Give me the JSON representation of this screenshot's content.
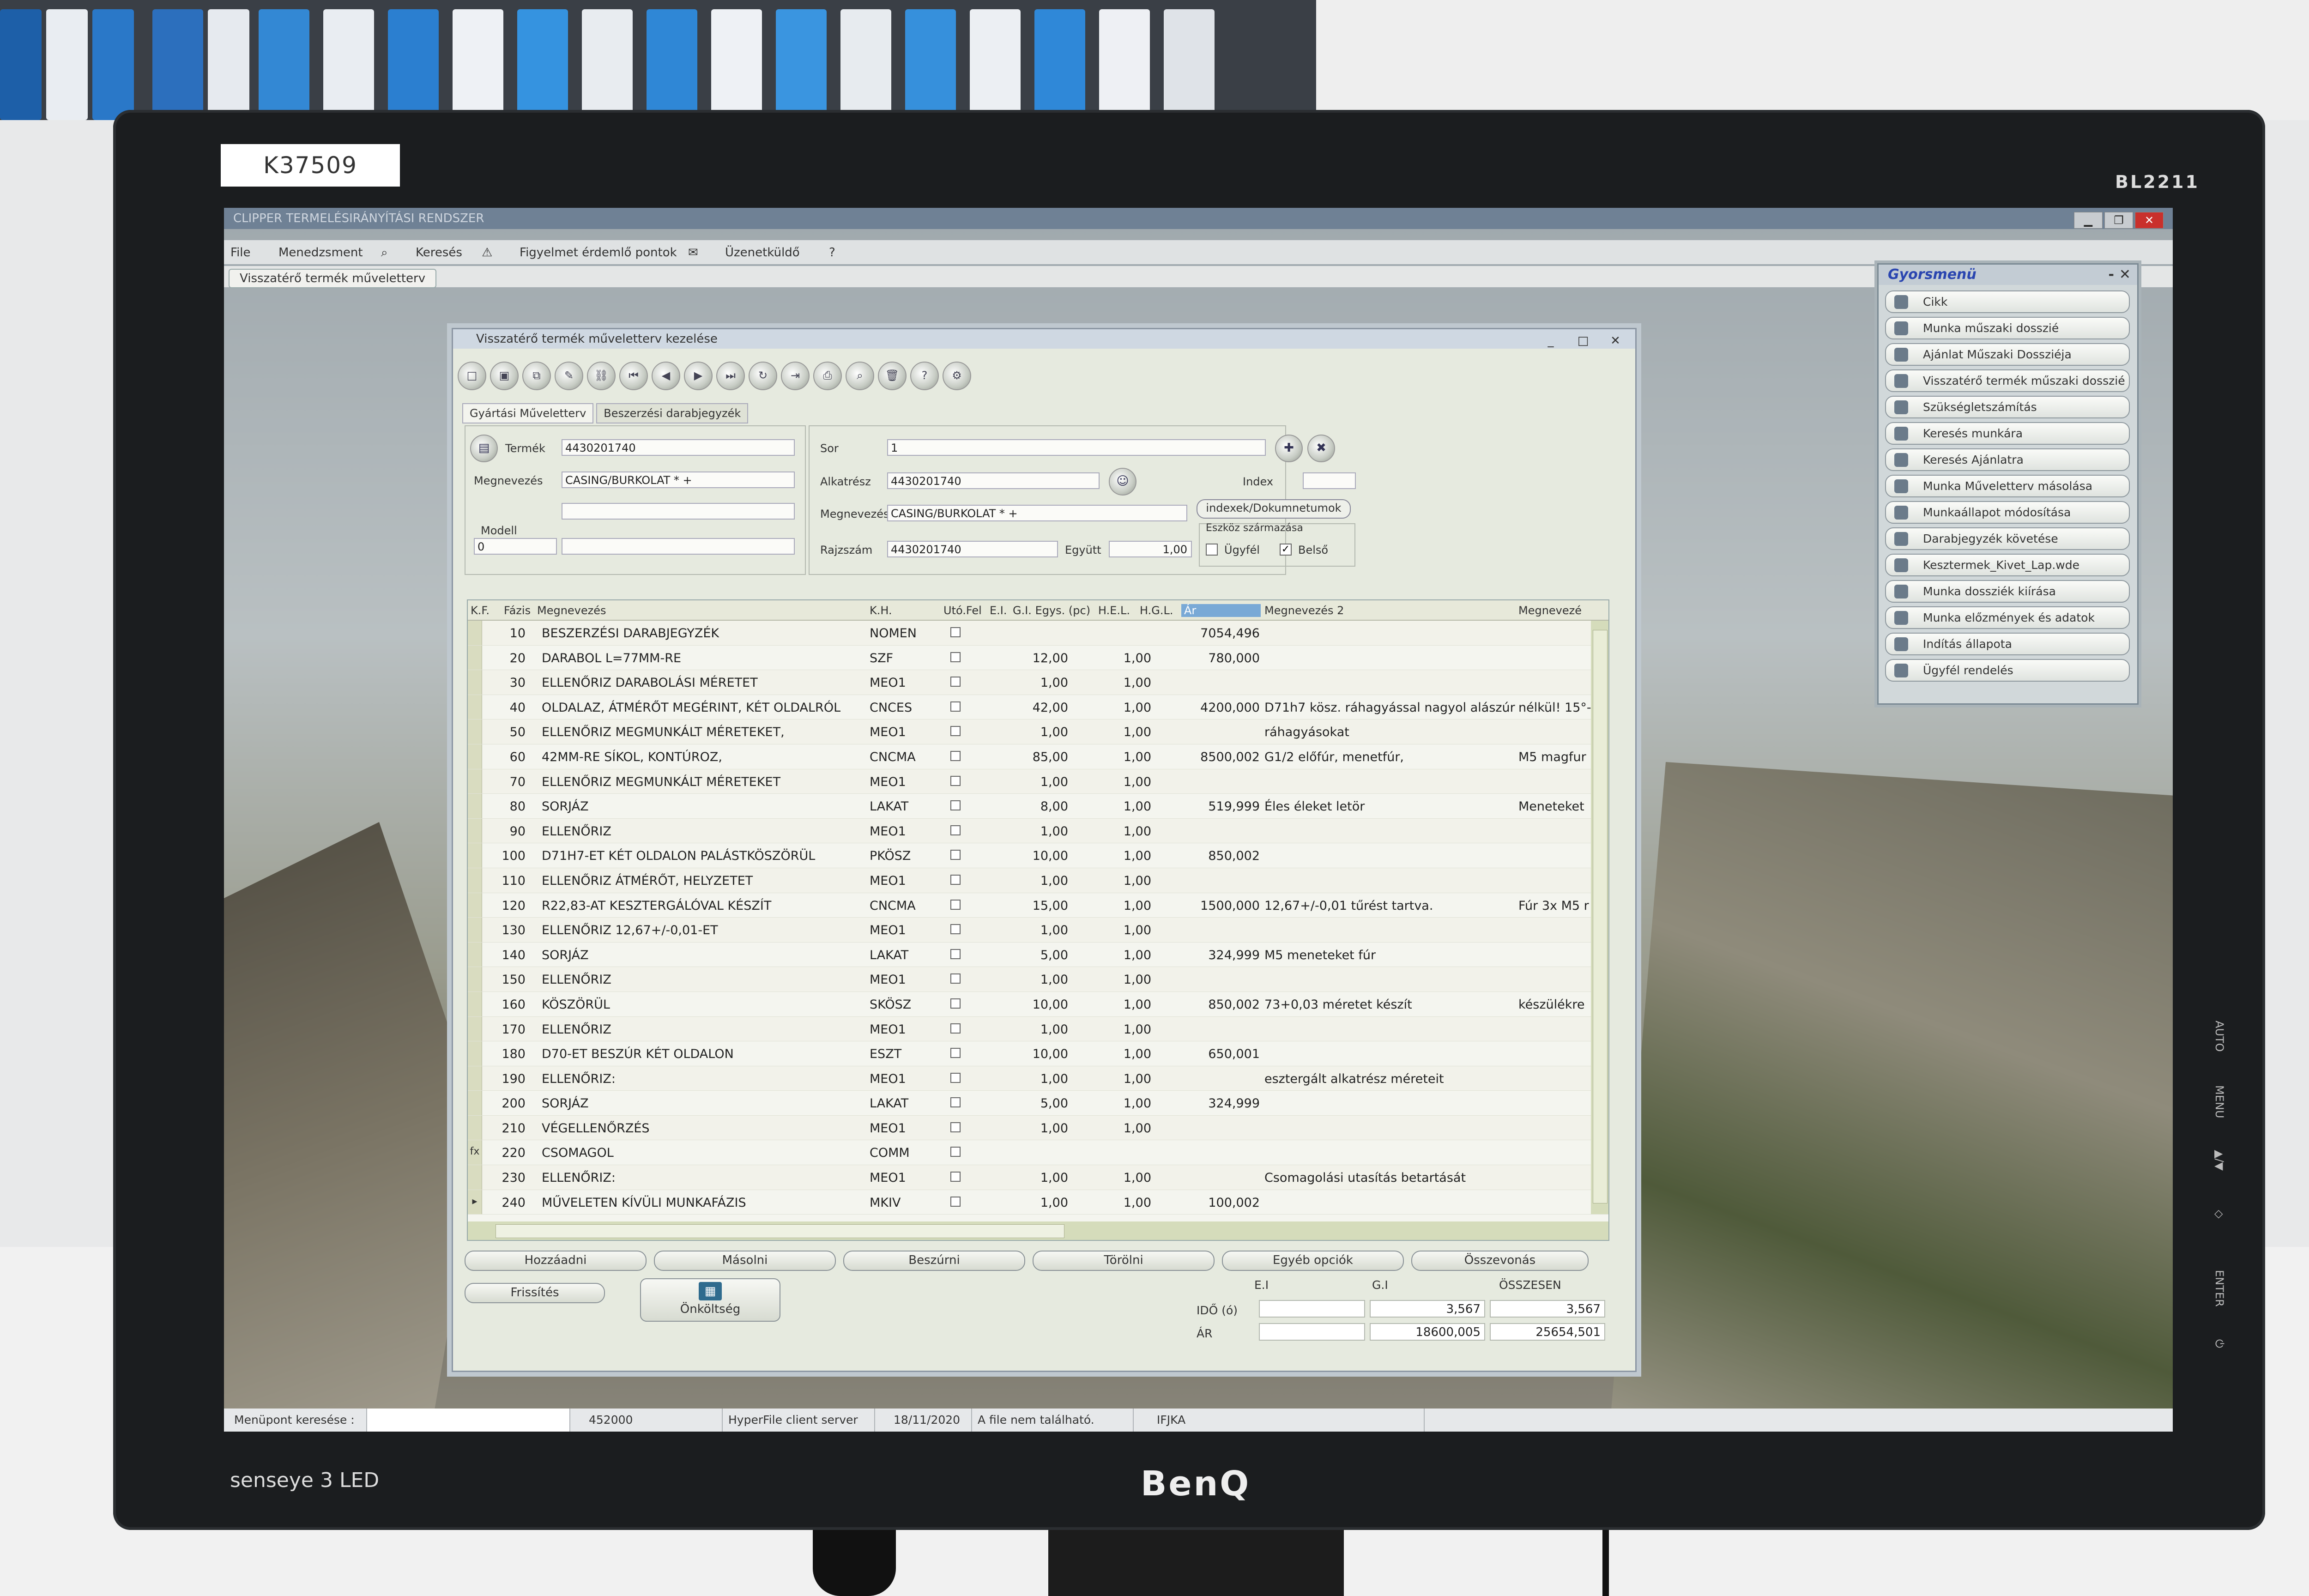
{
  "monitor": {
    "asset_label": "K37509",
    "model": "BL2211",
    "brand": "BenQ",
    "senseye": "senseye 3  LED",
    "osd_buttons": [
      "AUTO",
      "MENU",
      "▲/▼",
      "◇",
      "ENTER",
      "⏻"
    ]
  },
  "app": {
    "title": "CLIPPER TERMELÉSIRÁNYÍTÁSI RENDSZER",
    "window_buttons": [
      "▁",
      "❐",
      "✕"
    ],
    "menu": [
      "File",
      "Menedzsment",
      "Keresés",
      "Figyelmet érdemlő pontok",
      "Üzenetküldő",
      "?"
    ],
    "open_tab": "Visszatérő termék műveletterv"
  },
  "dialog": {
    "title": "Visszatérő termék műveletterv kezelése",
    "buttons": [
      "_",
      "□",
      "✕"
    ],
    "tabs": [
      "Gyártási Műveletterv",
      "Beszerzési darabjegyzék"
    ],
    "form": {
      "termek_label": "Termék",
      "termek_value": "4430201740",
      "megnevezes_label": "Megnevezés",
      "megnevezes_value": "CASING/BURKOLAT * +",
      "modell_label": "Modell",
      "modell_value": "0",
      "sor_label": "Sor",
      "sor_value": "1",
      "alkatresz_label": "Alkatrész",
      "alkatresz_value": "4430201740",
      "index_label": "Index",
      "megnevezes2_label": "Megnevezés",
      "megnevezes2_value": "CASING/BURKOLAT * +",
      "rajzszam_label": "Rajzszám",
      "rajzszam_value": "4430201740",
      "egyutt_label": "Együtt",
      "egyutt_value": "1,00",
      "indexek_button": "indexek/Dokumnetumok",
      "eszkoz_label": "Eszköz származása",
      "ugyfel_label": "Ügyfél",
      "belso_label": "Belső",
      "belso_checked": "✓"
    },
    "grid": {
      "headers": [
        "K.F.",
        "Fázis",
        "Megnevezés",
        "K.H.",
        "Utó.Fel",
        "E.I.",
        "G.I. Egys. (pc)",
        "H.E.L.",
        "H.G.L.",
        "Ár",
        "Megnevezés 2",
        "Megnevezé"
      ],
      "rows": [
        {
          "fazis": "10",
          "megnevezes": "BESZERZÉSI DARABJEGYZÉK",
          "kh": "NOMEN",
          "gi": "",
          "hgl": "",
          "ar": "7054,496",
          "m2": "",
          "m3": ""
        },
        {
          "fazis": "20",
          "megnevezes": "DARABOL L=77MM-RE",
          "kh": "SZF",
          "gi": "12,00",
          "hgl": "1,00",
          "ar": "780,000",
          "m2": "",
          "m3": ""
        },
        {
          "fazis": "30",
          "megnevezes": "ELLENŐRIZ DARABOLÁSI MÉRETET",
          "kh": "MEO1",
          "gi": "1,00",
          "hgl": "1,00",
          "ar": "",
          "m2": "",
          "m3": ""
        },
        {
          "fazis": "40",
          "megnevezes": "OLDALAZ, ÁTMÉRŐT MEGÉRINT, KÉT OLDALRÓL",
          "kh": "CNCES",
          "gi": "42,00",
          "hgl": "1,00",
          "ar": "4200,000",
          "m2": "D71h7 kösz. ráhagyással nagyol alászúr",
          "m3": "nélkül! 15°-"
        },
        {
          "fazis": "50",
          "megnevezes": "ELLENŐRIZ MEGMUNKÁLT MÉRETEKET,",
          "kh": "MEO1",
          "gi": "1,00",
          "hgl": "1,00",
          "ar": "",
          "m2": "ráhagyásokat",
          "m3": ""
        },
        {
          "fazis": "60",
          "megnevezes": "42MM-RE SÍKOL, KONTÚROZ,",
          "kh": "CNCMA",
          "gi": "85,00",
          "hgl": "1,00",
          "ar": "8500,002",
          "m2": "G1/2 előfúr, menetfúr,",
          "m3": "M5 magfur"
        },
        {
          "fazis": "70",
          "megnevezes": "ELLENŐRIZ MEGMUNKÁLT MÉRETEKET",
          "kh": "MEO1",
          "gi": "1,00",
          "hgl": "1,00",
          "ar": "",
          "m2": "",
          "m3": ""
        },
        {
          "fazis": "80",
          "megnevezes": "SORJÁZ",
          "kh": "LAKAT",
          "gi": "8,00",
          "hgl": "1,00",
          "ar": "519,999",
          "m2": "Éles éleket letör",
          "m3": "Meneteket"
        },
        {
          "fazis": "90",
          "megnevezes": "ELLENŐRIZ",
          "kh": "MEO1",
          "gi": "1,00",
          "hgl": "1,00",
          "ar": "",
          "m2": "",
          "m3": ""
        },
        {
          "fazis": "100",
          "megnevezes": "D71H7-ET KÉT OLDALON PALÁSTKÖSZÖRÜL",
          "kh": "PKÖSZ",
          "gi": "10,00",
          "hgl": "1,00",
          "ar": "850,002",
          "m2": "",
          "m3": ""
        },
        {
          "fazis": "110",
          "megnevezes": "ELLENŐRIZ ÁTMÉRŐT, HELYZETET",
          "kh": "MEO1",
          "gi": "1,00",
          "hgl": "1,00",
          "ar": "",
          "m2": "",
          "m3": ""
        },
        {
          "fazis": "120",
          "megnevezes": "R22,83-AT KESZTERGÁLÓVAL KÉSZÍT",
          "kh": "CNCMA",
          "gi": "15,00",
          "hgl": "1,00",
          "ar": "1500,000",
          "m2": "12,67+/-0,01 tűrést tartva.",
          "m3": "Fúr 3x M5 r"
        },
        {
          "fazis": "130",
          "megnevezes": "ELLENŐRIZ 12,67+/-0,01-ET",
          "kh": "MEO1",
          "gi": "1,00",
          "hgl": "1,00",
          "ar": "",
          "m2": "",
          "m3": ""
        },
        {
          "fazis": "140",
          "megnevezes": "SORJÁZ",
          "kh": "LAKAT",
          "gi": "5,00",
          "hgl": "1,00",
          "ar": "324,999",
          "m2": "M5 meneteket fúr",
          "m3": ""
        },
        {
          "fazis": "150",
          "megnevezes": "ELLENŐRIZ",
          "kh": "MEO1",
          "gi": "1,00",
          "hgl": "1,00",
          "ar": "",
          "m2": "",
          "m3": ""
        },
        {
          "fazis": "160",
          "megnevezes": "KÖSZÖRÜL",
          "kh": "SKÖSZ",
          "gi": "10,00",
          "hgl": "1,00",
          "ar": "850,002",
          "m2": "73+0,03 méretet készít",
          "m3": "készülékre"
        },
        {
          "fazis": "170",
          "megnevezes": "ELLENŐRIZ",
          "kh": "MEO1",
          "gi": "1,00",
          "hgl": "1,00",
          "ar": "",
          "m2": "",
          "m3": ""
        },
        {
          "fazis": "180",
          "megnevezes": "D70-ET BESZÚR KÉT OLDALON",
          "kh": "ESZT",
          "gi": "10,00",
          "hgl": "1,00",
          "ar": "650,001",
          "m2": "",
          "m3": ""
        },
        {
          "fazis": "190",
          "megnevezes": "ELLENŐRIZ:",
          "kh": "MEO1",
          "gi": "1,00",
          "hgl": "1,00",
          "ar": "",
          "m2": "esztergált alkatrész méreteit",
          "m3": ""
        },
        {
          "fazis": "200",
          "megnevezes": "SORJÁZ",
          "kh": "LAKAT",
          "gi": "5,00",
          "hgl": "1,00",
          "ar": "324,999",
          "m2": "",
          "m3": ""
        },
        {
          "fazis": "210",
          "megnevezes": "VÉGELLENŐRZÉS",
          "kh": "MEO1",
          "gi": "1,00",
          "hgl": "1,00",
          "ar": "",
          "m2": "",
          "m3": ""
        },
        {
          "fazis": "220",
          "megnevezes": "CSOMAGOL",
          "kh": "COMM",
          "gi": "",
          "hgl": "",
          "ar": "",
          "m2": "",
          "m3": "",
          "indic": "fx"
        },
        {
          "fazis": "230",
          "megnevezes": "ELLENŐRIZ:",
          "kh": "MEO1",
          "gi": "1,00",
          "hgl": "1,00",
          "ar": "",
          "m2": "Csomagolási utasítás betartását",
          "m3": ""
        },
        {
          "fazis": "240",
          "megnevezes": "MŰVELETEN KÍVÜLI MUNKAFÁZIS",
          "kh": "MKIV",
          "gi": "1,00",
          "hgl": "1,00",
          "ar": "100,002",
          "m2": "",
          "m3": "",
          "indic": "▸"
        }
      ]
    },
    "actions": [
      "Hozzáadni",
      "Másolni",
      "Beszúrni",
      "Törölni",
      "Egyéb opciók",
      "Összevonás"
    ],
    "frissites": "Frissítés",
    "onkoltseg": "Önköltség",
    "totals": {
      "ei": "E.I",
      "gi": "G.I",
      "osszesen": "ÖSSZESEN",
      "ido_label": "IDŐ (ó)",
      "ido_gi": "3,567",
      "ido_total": "3,567",
      "ar_label": "ÁR",
      "ar_gi": "18600,005",
      "ar_total": "25654,501"
    }
  },
  "quickmenu": {
    "title": "Gyorsmenü",
    "buttons": [
      "-",
      "✕"
    ],
    "items": [
      "Cikk",
      "Munka műszaki dosszié",
      "Ajánlat Műszaki Dossziéja",
      "Visszatérő termék műszaki dosszié",
      "Szükségletszámítás",
      "Keresés munkára",
      "Keresés Ajánlatra",
      "Munka Műveletterv másolása",
      "Munkaállapot módosítása",
      "Darabjegyzék követése",
      "Kesztermek_Kivet_Lap.wde",
      "Munka dossziék kiírása",
      "Munka előzmények és adatok",
      "Indítás állapota",
      "Ügyfél rendelés"
    ]
  },
  "statusbar": [
    "Menüpont keresése :",
    "452000",
    "HyperFile client server",
    "18/11/2020",
    "A file nem található.",
    "IFJKA"
  ]
}
